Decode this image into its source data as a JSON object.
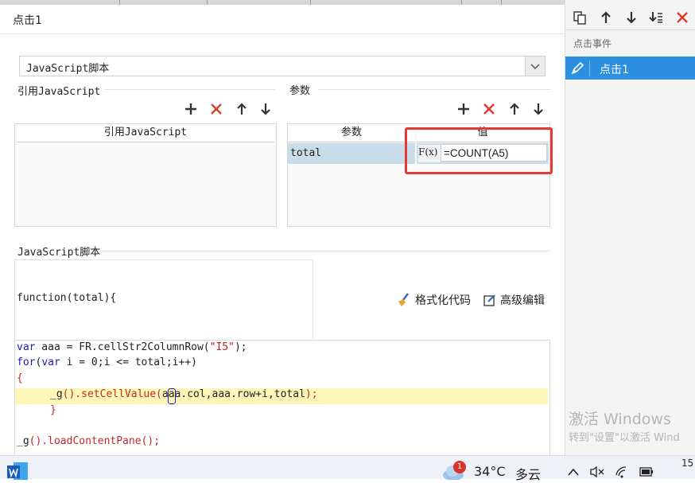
{
  "dialog": {
    "title": "点击1"
  },
  "script_type": {
    "selected": "JavaScript脚本"
  },
  "ref_js": {
    "section_label": "引用JavaScript",
    "column_header": "引用JavaScript"
  },
  "params": {
    "section_label": "参数",
    "headers": {
      "name": "参数",
      "value": "值"
    },
    "rows": [
      {
        "name": "total",
        "formula_icon": "F(x)",
        "value": "=COUNT(A5)"
      }
    ]
  },
  "js_script": {
    "section_label": "JavaScript脚本",
    "function_signature": "function(total){",
    "format_label": "格式化代码",
    "advanced_label": "高级编辑",
    "code": {
      "l1_kw": "var",
      "l1_a": " aaa = FR.cellStr2ColumnRow(",
      "l1_s": "\"I5\"",
      "l1_b": ");",
      "l2_kw": "for",
      "l2_a": "(",
      "l2_kw2": "var",
      "l2_b": " i = 0;i <= total;i++)",
      "l3": "{",
      "l4_a": "_g",
      "l4_b": "().setCellValue(",
      "l4_c": "aaa.col,aaa.row+i,total",
      "l4_d": ");",
      "l5": "}",
      "l6_a": "_g",
      "l6_b": "().loadContentPane",
      "l6_c": "();"
    }
  },
  "events_panel": {
    "header": "点击事件",
    "items": [
      {
        "label": "点击1"
      }
    ]
  },
  "watermark": {
    "line1": "激活 Windows",
    "line2": "转到\"设置\"以激活 Wind"
  },
  "taskbar": {
    "notify_count": "1",
    "temperature": "34°C",
    "weather": "多云",
    "clock_partial": "15"
  },
  "colors": {
    "accent": "#2d8fe0",
    "delete_red": "#e03a2b",
    "highlight_box": "#e53935"
  }
}
